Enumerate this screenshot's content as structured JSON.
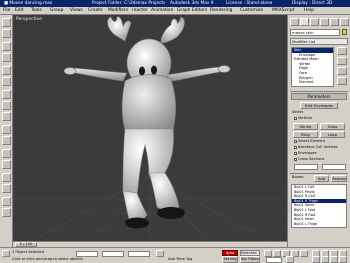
{
  "window": {
    "title_file": "■ Moose dancing.max",
    "title_project": "Project Folder: C:\\3dsmax Projects",
    "title_app": "Autodesk 3ds Max 9",
    "title_license": "License : Stand-alone",
    "title_display": "Display : Direct 3D"
  },
  "menu": [
    "File",
    "Edit",
    "Tools",
    "Group",
    "Views",
    "Create",
    "Modifiers",
    "reactor",
    "Animation",
    "Graph Editors",
    "Rendering",
    "Customize",
    "MAXScript",
    "Help"
  ],
  "viewport": {
    "label": "Perspective"
  },
  "panel": {
    "object_name": "moose skin",
    "modifier_list": "Modifier List",
    "stack": [
      {
        "label": "Skin",
        "selected": true,
        "indent": false
      },
      {
        "label": "Envelope",
        "selected": false,
        "indent": true
      },
      {
        "label": "Editable Mesh",
        "selected": false,
        "indent": false
      },
      {
        "label": "Vertex",
        "selected": false,
        "indent": true
      },
      {
        "label": "Edge",
        "selected": false,
        "indent": true
      },
      {
        "label": "Face",
        "selected": false,
        "indent": true
      },
      {
        "label": "Polygon",
        "selected": false,
        "indent": true
      },
      {
        "label": "Element",
        "selected": false,
        "indent": true
      }
    ],
    "rollout_parameters": "Parameters",
    "edit_envelopes": "Edit Envelopes",
    "select_group": "Select",
    "vertices": "Vertices",
    "shrink": "Shrink",
    "grow": "Grow",
    "ring": "Ring",
    "loop": "Loop",
    "select_element": "Select Element",
    "backface_cull": "Backface Cull Vertices",
    "envelopes": "Envelopes",
    "cross_sections": "Cross Sections",
    "bones_label": "Bones:",
    "add": "Add",
    "remove": "Remove",
    "bones": [
      {
        "label": "Bip01 L Calf",
        "selected": false
      },
      {
        "label": "Bip01 Pelvis",
        "selected": false
      },
      {
        "label": "Bip01 R Calf",
        "selected": false
      },
      {
        "label": "Bip01 R Thigh",
        "selected": true
      },
      {
        "label": "Bip01 Spine",
        "selected": false
      },
      {
        "label": "Bip01 L Foot",
        "selected": false
      },
      {
        "label": "Bip01 R Foot",
        "selected": false
      },
      {
        "label": "Bip01 Head",
        "selected": false
      },
      {
        "label": "Bip01 L Thigh",
        "selected": false
      }
    ]
  },
  "timeline": {
    "frame": "0 / 100"
  },
  "status": {
    "selected": "1 Object Selected",
    "prompt": "Click or click-and-drag to select objects",
    "addtime": "Add Time Tag",
    "autokey": "Auto Key",
    "setkey": "Set Key",
    "selected_dd": "Selected",
    "keyfilters": "Key Filters..."
  },
  "colors": {
    "viewport_bg": "#3b3b3b",
    "body": "#c8c8c8",
    "pants": "#e4e4e4",
    "antler": "#f0f0f0",
    "shoe": "#151515",
    "selection_blue": "#0a246a",
    "autokey_red": "#c00000"
  }
}
